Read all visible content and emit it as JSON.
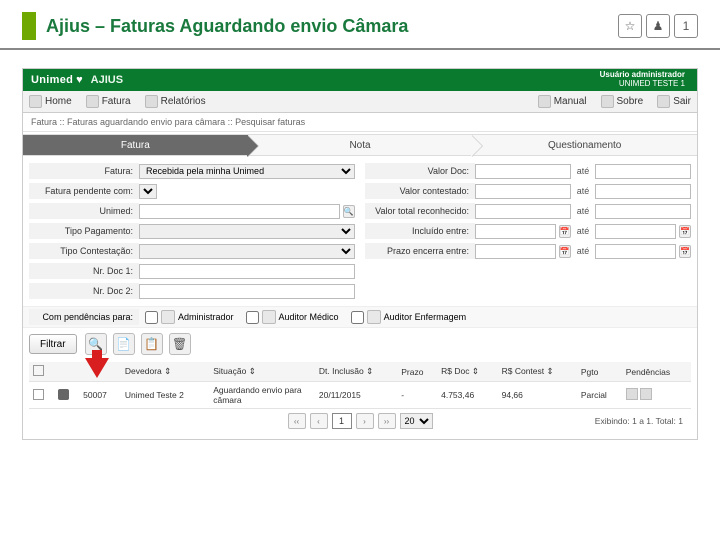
{
  "slide": {
    "title": "Ajius – Faturas Aguardando envio Câmara",
    "badge": "1"
  },
  "app": {
    "brand": "Unimed",
    "module": "AJIUS",
    "user_line1": "Usuário administrador",
    "user_line2": "UNIMED TESTE 1"
  },
  "menu": {
    "home": "Home",
    "fatura": "Fatura",
    "relatorios": "Relatórios",
    "manual": "Manual",
    "sobre": "Sobre",
    "sair": "Sair"
  },
  "breadcrumb": "Fatura :: Faturas aguardando envio para câmara :: Pesquisar faturas",
  "steps": {
    "s1": "Fatura",
    "s2": "Nota",
    "s3": "Questionamento"
  },
  "form": {
    "left": {
      "fatura": "Fatura:",
      "fatura_val": "Recebida pela minha Unimed",
      "pendente": "Fatura pendente com:",
      "unimed": "Unimed:",
      "tipo_pag": "Tipo Pagamento:",
      "tipo_cont": "Tipo Contestação:",
      "doc1": "Nr. Doc 1:",
      "doc2": "Nr. Doc 2:"
    },
    "right": {
      "valor_doc": "Valor Doc:",
      "valor_cont": "Valor contestado:",
      "valor_rec": "Valor total reconhecido:",
      "incluido": "Incluído entre:",
      "prazo": "Prazo encerra entre:",
      "ate": "até"
    }
  },
  "pend": {
    "label": "Com pendências para:",
    "admin": "Administrador",
    "medico": "Auditor Médico",
    "enf": "Auditor Enfermagem"
  },
  "filter_btn": "Filtrar",
  "table": {
    "headers": {
      "c1": "",
      "c2": "",
      "c3": "",
      "devedora": "Devedora ⇕",
      "situacao": "Situação ⇕",
      "dtinc": "Dt. Inclusão ⇕",
      "prazo": "Prazo",
      "rsdoc": "R$ Doc ⇕",
      "rscont": "R$ Contest ⇕",
      "pgto": "Pgto",
      "pend": "Pendências"
    },
    "row": {
      "id": "50007",
      "devedora": "Unimed Teste 2",
      "situacao": "Aguardando envio para câmara",
      "dtinc": "20/11/2015",
      "prazo": "-",
      "rsdoc": "4.753,46",
      "rscont": "94,66",
      "pgto": "Parcial"
    }
  },
  "pager": {
    "first": "‹‹",
    "prev": "‹",
    "cur": "1",
    "next": "›",
    "last": "››",
    "size": "20",
    "summary": "Exibindo: 1 a 1. Total: 1"
  }
}
